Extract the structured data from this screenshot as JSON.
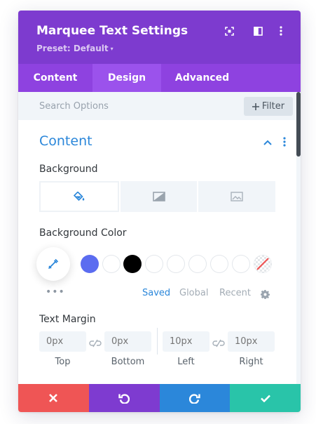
{
  "header": {
    "title": "Marquee Text Settings",
    "preset_label": "Preset: Default",
    "preset_caret": "▾",
    "icons": [
      "expand-icon",
      "sidebar-layout-icon",
      "more-vertical-icon"
    ]
  },
  "tabs": [
    {
      "label": "Content",
      "active": false
    },
    {
      "label": "Design",
      "active": true
    },
    {
      "label": "Advanced",
      "active": false
    }
  ],
  "search": {
    "placeholder": "Search Options",
    "filter_label": "Filter",
    "filter_icon": "plus-icon"
  },
  "section": {
    "title": "Content",
    "toggle_icon": "chevron-up-icon",
    "menu_icon": "more-vertical-icon"
  },
  "background": {
    "label": "Background",
    "types": [
      {
        "name": "color",
        "icon": "paint-bucket-icon",
        "active": true
      },
      {
        "name": "gradient",
        "icon": "gradient-icon",
        "active": false
      },
      {
        "name": "image",
        "icon": "image-icon",
        "active": false
      }
    ]
  },
  "background_color": {
    "label": "Background Color",
    "picker_icon": "eyedropper-icon",
    "swatches": [
      "#5b6cf0",
      "#ffffff",
      "#000000",
      "#ffffff",
      "#ffffff",
      "#ffffff",
      "#ffffff",
      "#ffffff",
      "none"
    ],
    "more_label": "•••",
    "palette_tabs": [
      {
        "label": "Saved",
        "active": true
      },
      {
        "label": "Global",
        "active": false
      },
      {
        "label": "Recent",
        "active": false
      }
    ],
    "settings_icon": "gear-icon"
  },
  "text_margin": {
    "label": "Text Margin",
    "fields": [
      {
        "placeholder": "0px",
        "sublabel": "Top"
      },
      {
        "placeholder": "0px",
        "sublabel": "Bottom"
      },
      {
        "placeholder": "10px",
        "sublabel": "Left"
      },
      {
        "placeholder": "10px",
        "sublabel": "Right"
      }
    ],
    "link_icon": "link-icon"
  },
  "footer": {
    "buttons": [
      {
        "name": "cancel",
        "icon": "close-icon",
        "color": "#ef5555"
      },
      {
        "name": "undo",
        "icon": "undo-icon",
        "color": "#7e3bd0"
      },
      {
        "name": "redo",
        "icon": "redo-icon",
        "color": "#2b87da"
      },
      {
        "name": "save",
        "icon": "checkmark-icon",
        "color": "#29c4a9"
      }
    ]
  },
  "colors": {
    "header_bg": "#7d3bcf",
    "tabs_bg": "#8e42e0",
    "tab_active_bg": "#9b52ec",
    "accent_blue": "#2b87da"
  }
}
